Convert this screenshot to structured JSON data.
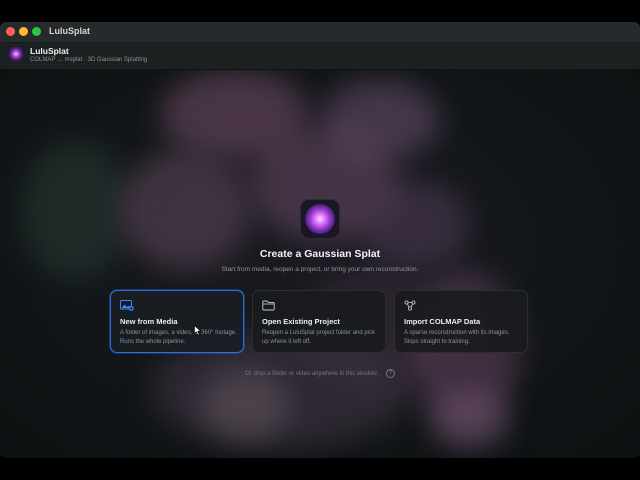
{
  "window": {
    "title": "LuluSplat"
  },
  "appbar": {
    "name": "LuluSplat",
    "subtitle": "COLMAP → msplat · 3D Gaussian Splatting"
  },
  "main": {
    "heading": "Create a Gaussian Splat",
    "subheading": "Start from media, reopen a project, or bring your own reconstruction.",
    "cards": [
      {
        "title": "New from Media",
        "description": "A folder of images, a video, or 360° footage. Runs the whole pipeline.",
        "icon": "photo-add-icon",
        "selected": true
      },
      {
        "title": "Open Existing Project",
        "description": "Reopen a LuluSplat project folder and pick up where it left off.",
        "icon": "folder-icon",
        "selected": false
      },
      {
        "title": "Import COLMAP Data",
        "description": "A sparse reconstruction with its images. Skips straight to training.",
        "icon": "graph-nodes-icon",
        "selected": false
      }
    ],
    "hint": "Or drop a folder or video anywhere in this window.",
    "help_glyph": "?"
  },
  "colors": {
    "accent": "#2a6fe0",
    "close": "#fe5f57",
    "minimize": "#febc2e",
    "maximize": "#28c840"
  }
}
